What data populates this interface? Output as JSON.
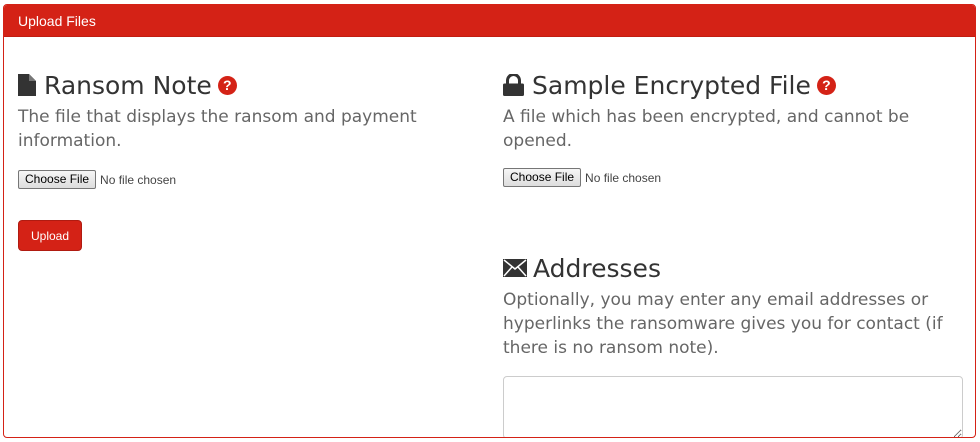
{
  "panel": {
    "title": "Upload Files"
  },
  "ransom_note": {
    "title": "Ransom Note",
    "help": "?",
    "description": "The file that displays the ransom and payment information.",
    "file_button": "Choose File",
    "file_status": "No file chosen",
    "upload_button": "Upload"
  },
  "sample_file": {
    "title": "Sample Encrypted File",
    "help": "?",
    "description": "A file which has been encrypted, and cannot be opened.",
    "file_button": "Choose File",
    "file_status": "No file chosen"
  },
  "addresses": {
    "title": "Addresses",
    "description": "Optionally, you may enter any email addresses or hyperlinks the ransomware gives you for contact (if there is no ransom note).",
    "value": ""
  },
  "icons": {
    "ransom_note": "file-icon",
    "sample_file": "lock-icon",
    "addresses": "envelope-icon",
    "help": "question-circle-icon"
  },
  "colors": {
    "accent": "#d42216"
  }
}
